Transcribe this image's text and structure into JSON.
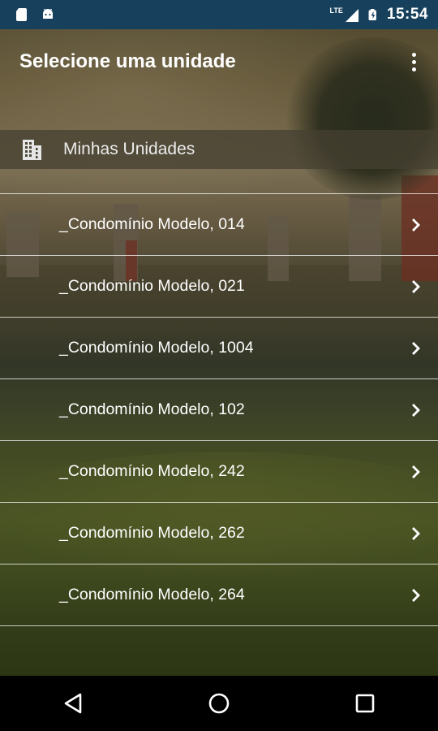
{
  "status_bar": {
    "network": "LTE",
    "time": "15:54",
    "icons": [
      "sd-card-icon",
      "android-icon",
      "signal-icon",
      "battery-charging-icon"
    ]
  },
  "app_bar": {
    "title": "Selecione uma unidade",
    "overflow_icon": "more-vert-icon"
  },
  "section": {
    "icon": "building-icon",
    "title": "Minhas Unidades"
  },
  "units": [
    {
      "label": "_Condomínio Modelo, 014"
    },
    {
      "label": "_Condomínio Modelo, 021"
    },
    {
      "label": "_Condomínio Modelo, 1004"
    },
    {
      "label": "_Condomínio Modelo, 102"
    },
    {
      "label": "_Condomínio Modelo, 242"
    },
    {
      "label": "_Condomínio Modelo, 262"
    },
    {
      "label": "_Condomínio Modelo, 264"
    }
  ],
  "nav_bar": {
    "buttons": [
      "back-icon",
      "home-icon",
      "recents-icon"
    ]
  },
  "colors": {
    "status_bar": "#17405c",
    "text": "#ffffff"
  }
}
